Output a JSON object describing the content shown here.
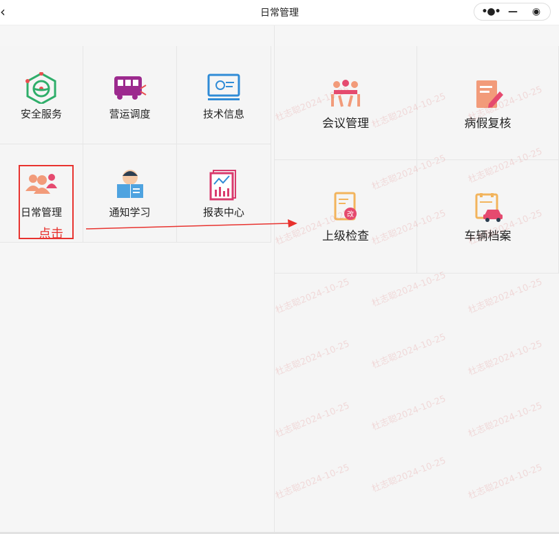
{
  "header": {
    "back_icon": "‹",
    "title": "日常管理",
    "more_icon": "•●•",
    "minimize_icon": "—",
    "close_icon": "◉"
  },
  "left_grid": [
    {
      "label": "安全服务",
      "icon": "steering-wheel-icon"
    },
    {
      "label": "营运调度",
      "icon": "bus-icon"
    },
    {
      "label": "技术信息",
      "icon": "monitor-gear-icon"
    },
    {
      "label": "日常管理",
      "icon": "people-icon"
    },
    {
      "label": "通知学习",
      "icon": "reading-person-icon"
    },
    {
      "label": "报表中心",
      "icon": "chart-report-icon"
    }
  ],
  "right_grid": [
    {
      "label": "会议管理",
      "icon": "meeting-icon"
    },
    {
      "label": "病假复核",
      "icon": "edit-document-icon"
    },
    {
      "label": "上级检查",
      "icon": "inspection-doc-icon"
    },
    {
      "label": "车辆档案",
      "icon": "car-file-icon"
    }
  ],
  "annotation": {
    "click_label": "点击"
  },
  "watermark": "杜志聪2024-10-25",
  "colors": {
    "highlight": "#e8322e",
    "watermark": "#dc5a5a"
  }
}
